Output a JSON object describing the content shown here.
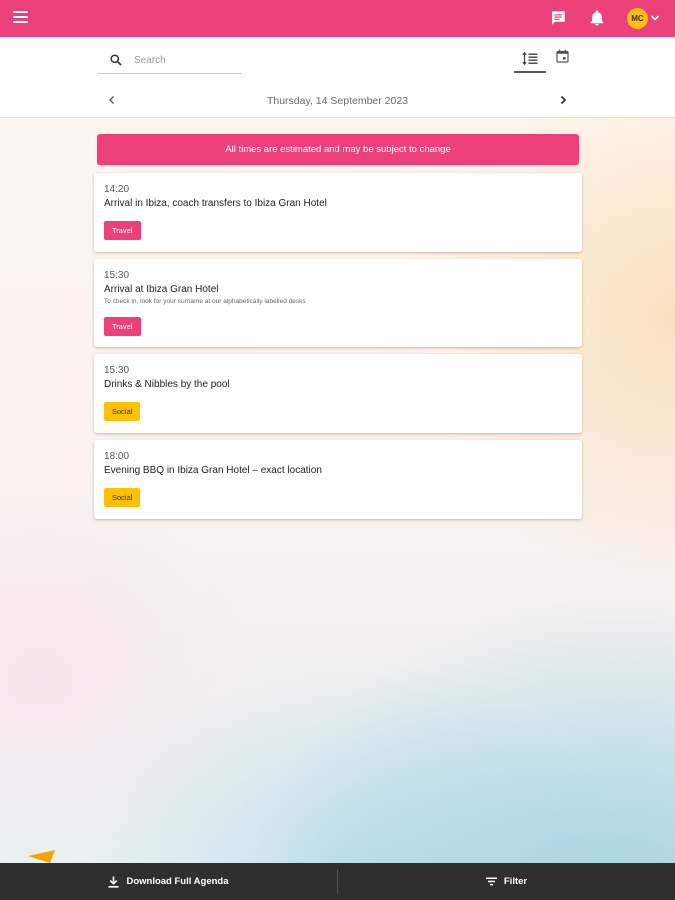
{
  "topbar": {
    "menu_icon": "hamburger-menu-icon",
    "chat_icon": "chat-bubble-icon",
    "notifications_icon": "bell-icon",
    "avatar_initials": "MC",
    "avatar_color": "#ffc107",
    "brand_color": "#ec407a"
  },
  "search": {
    "placeholder": "Search",
    "value": ""
  },
  "view_toggle": {
    "list_icon": "list-view-icon",
    "calendar_icon": "calendar-icon",
    "active": "list"
  },
  "date_nav": {
    "current_date": "Thursday, 14 September 2023"
  },
  "banner": {
    "text": "All times are estimated and may be subject to change"
  },
  "agenda": [
    {
      "time": "14:20",
      "title": "Arrival in Ibiza, coach transfers to Ibiza Gran Hotel",
      "description": "",
      "tag": "Travel",
      "tag_color": "#ec407a"
    },
    {
      "time": "15:30",
      "title": "Arrival at Ibiza Gran Hotel",
      "description": "To check in, look for your surname at our alphabetically labelled desks",
      "tag": "Travel",
      "tag_color": "#ec407a"
    },
    {
      "time": "15:30",
      "title": "Drinks & Nibbles by the pool",
      "description": "",
      "tag": "Social",
      "tag_color": "#ffc107"
    },
    {
      "time": "18:00",
      "title": "Evening BBQ in Ibiza Gran Hotel – exact location",
      "description": "",
      "tag": "Social",
      "tag_color": "#ffc107"
    }
  ],
  "bottombar": {
    "download_label": "Download Full Agenda",
    "filter_label": "Filter",
    "download_icon": "download-icon",
    "filter_icon": "filter-icon"
  }
}
